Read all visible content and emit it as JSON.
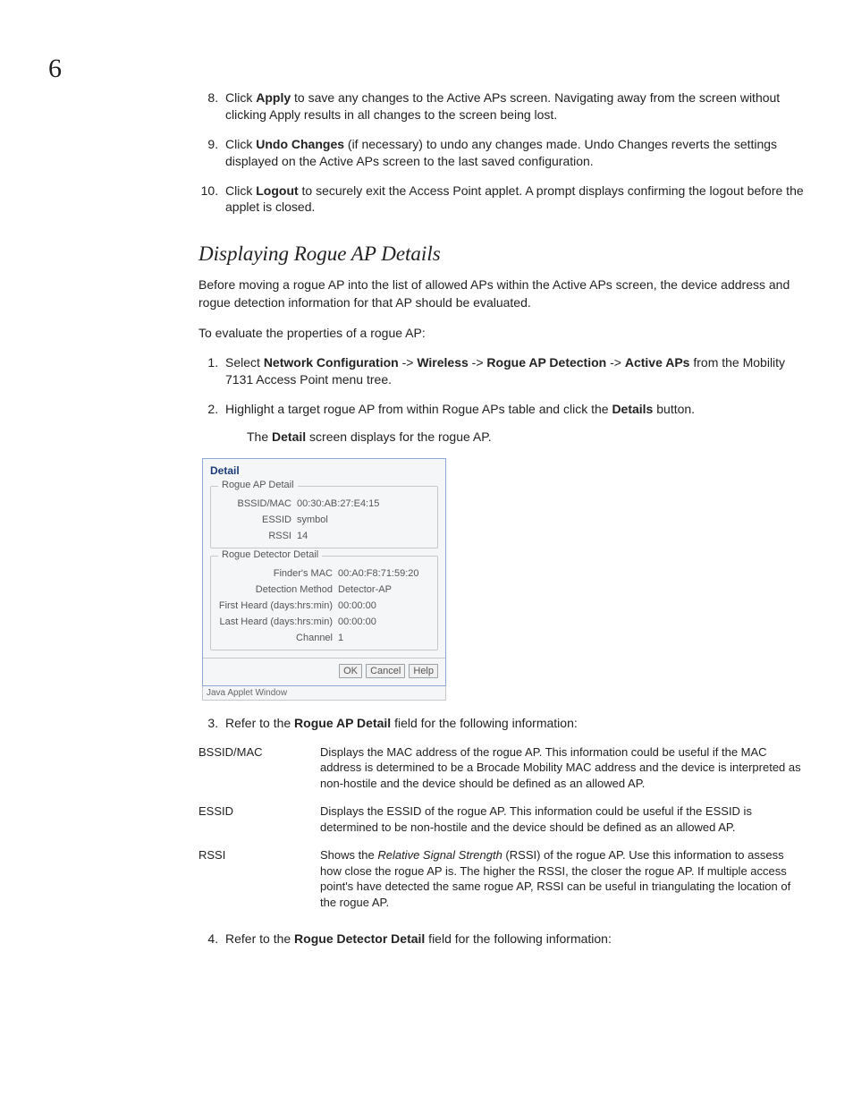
{
  "section_number": "6",
  "steps_first": [
    {
      "n": 8,
      "prefix": "Click ",
      "bold": "Apply",
      "suffix": " to save any changes to the Active APs screen. Navigating away from the screen without clicking Apply results in all changes to the screen being lost."
    },
    {
      "n": 9,
      "prefix": "Click ",
      "bold": "Undo Changes",
      "suffix": " (if necessary) to undo any changes made. Undo Changes reverts the settings displayed on the Active APs screen to the last saved configuration."
    },
    {
      "n": 10,
      "prefix": "Click ",
      "bold": "Logout",
      "suffix": " to securely exit the Access Point applet. A prompt displays confirming the logout before the applet is closed."
    }
  ],
  "heading": "Displaying Rogue AP Details",
  "intro1": "Before moving a rogue AP into the list of allowed APs within the Active APs screen, the device address and rogue detection information for that AP should be evaluated.",
  "intro2": "To evaluate the properties of a rogue AP:",
  "steps_second": {
    "s1": {
      "prefix": "Select ",
      "b1": "Network Configuration",
      "a1": " -> ",
      "b2": "Wireless",
      "a2": " -> ",
      "b3": "Rogue AP Detection",
      "a3": " -> ",
      "b4": "Active APs",
      "suffix": " from the Mobility 7131 Access Point menu tree."
    },
    "s2": {
      "prefix": "Highlight a target rogue AP from within Rogue APs table and click the ",
      "bold": "Details",
      "suffix": " button.",
      "sub_prefix": "The ",
      "sub_bold": "Detail",
      "sub_suffix": " screen displays for the rogue AP."
    },
    "s3": {
      "prefix": "Refer to the ",
      "bold": "Rogue AP Detail",
      "suffix": " field for the following information:"
    },
    "s4": {
      "prefix": "Refer to the ",
      "bold": "Rogue Detector Detail",
      "suffix": " field for the following information:"
    }
  },
  "dialog": {
    "title": "Detail",
    "group1": {
      "legend": "Rogue AP Detail",
      "bssid_label": "BSSID/MAC",
      "bssid_value": "00:30:AB:27:E4:15",
      "essid_label": "ESSID",
      "essid_value": "symbol",
      "rssi_label": "RSSI",
      "rssi_value": "14"
    },
    "group2": {
      "legend": "Rogue Detector Detail",
      "finder_label": "Finder's MAC",
      "finder_value": "00:A0:F8:71:59:20",
      "method_label": "Detection Method",
      "method_value": "Detector-AP",
      "first_label": "First Heard (days:hrs:min)",
      "first_value": "00:00:00",
      "last_label": "Last Heard (days:hrs:min)",
      "last_value": "00:00:00",
      "channel_label": "Channel",
      "channel_value": "1"
    },
    "buttons": {
      "ok": "OK",
      "cancel": "Cancel",
      "help": "Help"
    },
    "status": "Java Applet Window"
  },
  "defs": {
    "bssid_term": "BSSID/MAC",
    "bssid_desc": "Displays the MAC address of the rogue AP. This information could be useful if the MAC address is determined to be a Brocade Mobility MAC address and the device is interpreted as non-hostile and the device should be defined as an allowed AP.",
    "essid_term": "ESSID",
    "essid_desc": "Displays the ESSID of the rogue AP. This information could be useful if the ESSID is determined to be non-hostile and the device should be defined as an allowed AP.",
    "rssi_term": "RSSI",
    "rssi_pre": "Shows the ",
    "rssi_italic": "Relative Signal Strength",
    "rssi_post": " (RSSI) of the rogue AP. Use this information to assess how close the rogue AP is. The higher the RSSI, the closer the rogue AP. If multiple access point's have detected the same rogue AP, RSSI can be useful in triangulating the location of the rogue AP."
  }
}
